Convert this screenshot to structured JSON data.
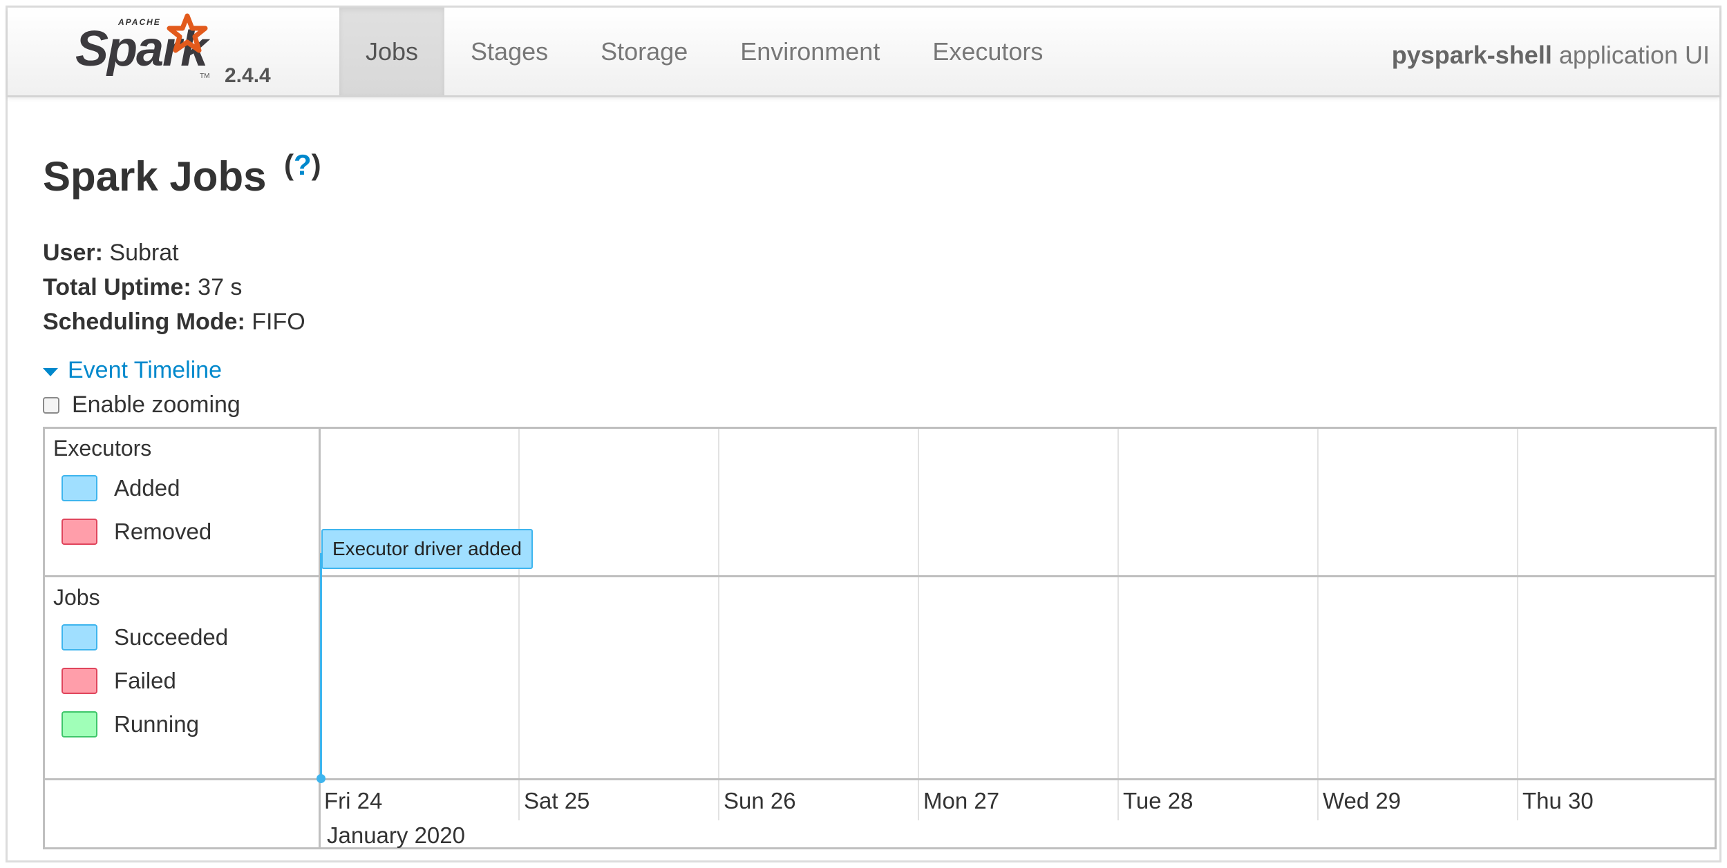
{
  "brand": {
    "apache": "APACHE",
    "name": "Spark",
    "tm": "TM",
    "version": "2.4.4",
    "star_color": "#e25a1c"
  },
  "nav": {
    "tabs": [
      "Jobs",
      "Stages",
      "Storage",
      "Environment",
      "Executors"
    ],
    "active_tab": "Jobs",
    "app_name": "pyspark-shell",
    "app_suffix": "application UI"
  },
  "page": {
    "title": "Spark Jobs",
    "help_open": "(",
    "help_q": "?",
    "help_close": ")"
  },
  "summary": {
    "user_label": "User:",
    "user_value": "Subrat",
    "uptime_label": "Total Uptime:",
    "uptime_value": "37 s",
    "mode_label": "Scheduling Mode:",
    "mode_value": "FIFO"
  },
  "timeline": {
    "toggle_label": "Event Timeline",
    "zoom_label": "Enable zooming",
    "zoom_enabled": false,
    "executors_group": "Executors",
    "executors_legend": [
      "Added",
      "Removed"
    ],
    "jobs_group": "Jobs",
    "jobs_legend": [
      "Succeeded",
      "Failed",
      "Running"
    ],
    "days": [
      "Fri 24",
      "Sat 25",
      "Sun 26",
      "Mon 27",
      "Tue 28",
      "Wed 29",
      "Thu 30"
    ],
    "month": "January 2020",
    "event_label": "Executor driver added",
    "colors": {
      "added": "#a0dfff",
      "removed": "#ff9eaa",
      "running": "#a0ffb8",
      "link": "#0088cc"
    }
  }
}
